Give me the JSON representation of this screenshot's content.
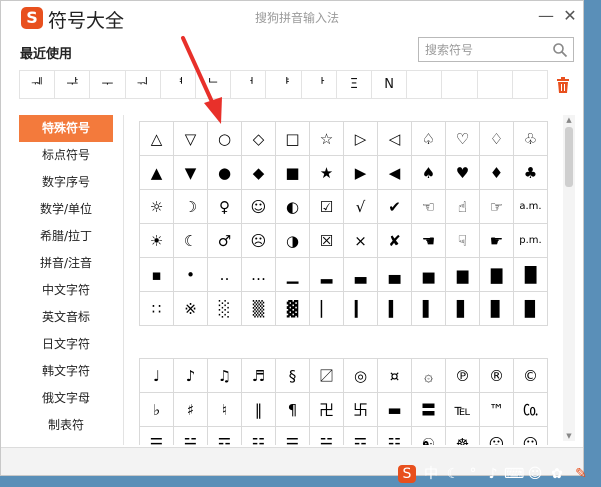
{
  "titlebar": {
    "logo_letter": "S",
    "app_title": "符号大全",
    "center_title": "搜狗拼音输入法",
    "minimize": "—",
    "close": "✕"
  },
  "recent": {
    "label": "最近使用",
    "items": [
      "ᅰ",
      "ᅷ",
      "ᅮ",
      "ᅯ",
      "ᅧ",
      "ᄂ",
      "ᅥ",
      "ᅣ",
      "ᅡ",
      "Ξ",
      "N",
      "",
      "",
      "",
      ""
    ]
  },
  "search": {
    "placeholder": "搜索符号"
  },
  "sidebar": {
    "items": [
      {
        "label": "特殊符号",
        "active": true
      },
      {
        "label": "标点符号",
        "active": false
      },
      {
        "label": "数字序号",
        "active": false
      },
      {
        "label": "数学/单位",
        "active": false
      },
      {
        "label": "希腊/拉丁",
        "active": false
      },
      {
        "label": "拼音/注音",
        "active": false
      },
      {
        "label": "中文字符",
        "active": false
      },
      {
        "label": "英文音标",
        "active": false
      },
      {
        "label": "日文字符",
        "active": false
      },
      {
        "label": "韩文字符",
        "active": false
      },
      {
        "label": "俄文字母",
        "active": false
      },
      {
        "label": "制表符",
        "active": false
      }
    ]
  },
  "grid1": [
    [
      "△",
      "▽",
      "○",
      "◇",
      "□",
      "☆",
      "▷",
      "◁",
      "♤",
      "♡",
      "♢",
      "♧"
    ],
    [
      "▲",
      "▼",
      "●",
      "◆",
      "■",
      "★",
      "▶",
      "◀",
      "♠",
      "♥",
      "♦",
      "♣"
    ],
    [
      "☼",
      "☽",
      "♀",
      "☺",
      "◐",
      "☑",
      "√",
      "✔",
      "☜",
      "☝",
      "☞",
      "a.m."
    ],
    [
      "☀",
      "☾",
      "♂",
      "☹",
      "◑",
      "☒",
      "×",
      "✘",
      "☚",
      "☟",
      "☛",
      "p.m."
    ],
    [
      "▪",
      "•",
      "‥",
      "…",
      "▁",
      "▂",
      "▃",
      "▄",
      "▅",
      "▆",
      "▇",
      "█"
    ],
    [
      "∷",
      "※",
      "░",
      "▒",
      "▓",
      "▏",
      "▎",
      "▍",
      "▌",
      "▋",
      "▊",
      "▉"
    ]
  ],
  "grid2": [
    [
      "♩",
      "♪",
      "♫",
      "♬",
      "§",
      "〼",
      "◎",
      "¤",
      "۞",
      "℗",
      "®",
      "©"
    ],
    [
      "♭",
      "♯",
      "♮",
      "‖",
      "¶",
      "卍",
      "卐",
      "▬",
      "〓",
      "℡",
      "™",
      "㏇"
    ],
    [
      "☰",
      "☱",
      "☲",
      "☳",
      "☴",
      "☵",
      "☶",
      "☷",
      "☯",
      "☸",
      "☹",
      "☺"
    ]
  ],
  "colors": {
    "accent": "#f37a3c",
    "logo": "#e8501e",
    "arrow": "#e8302a",
    "desktop": "#5a8fb8"
  }
}
